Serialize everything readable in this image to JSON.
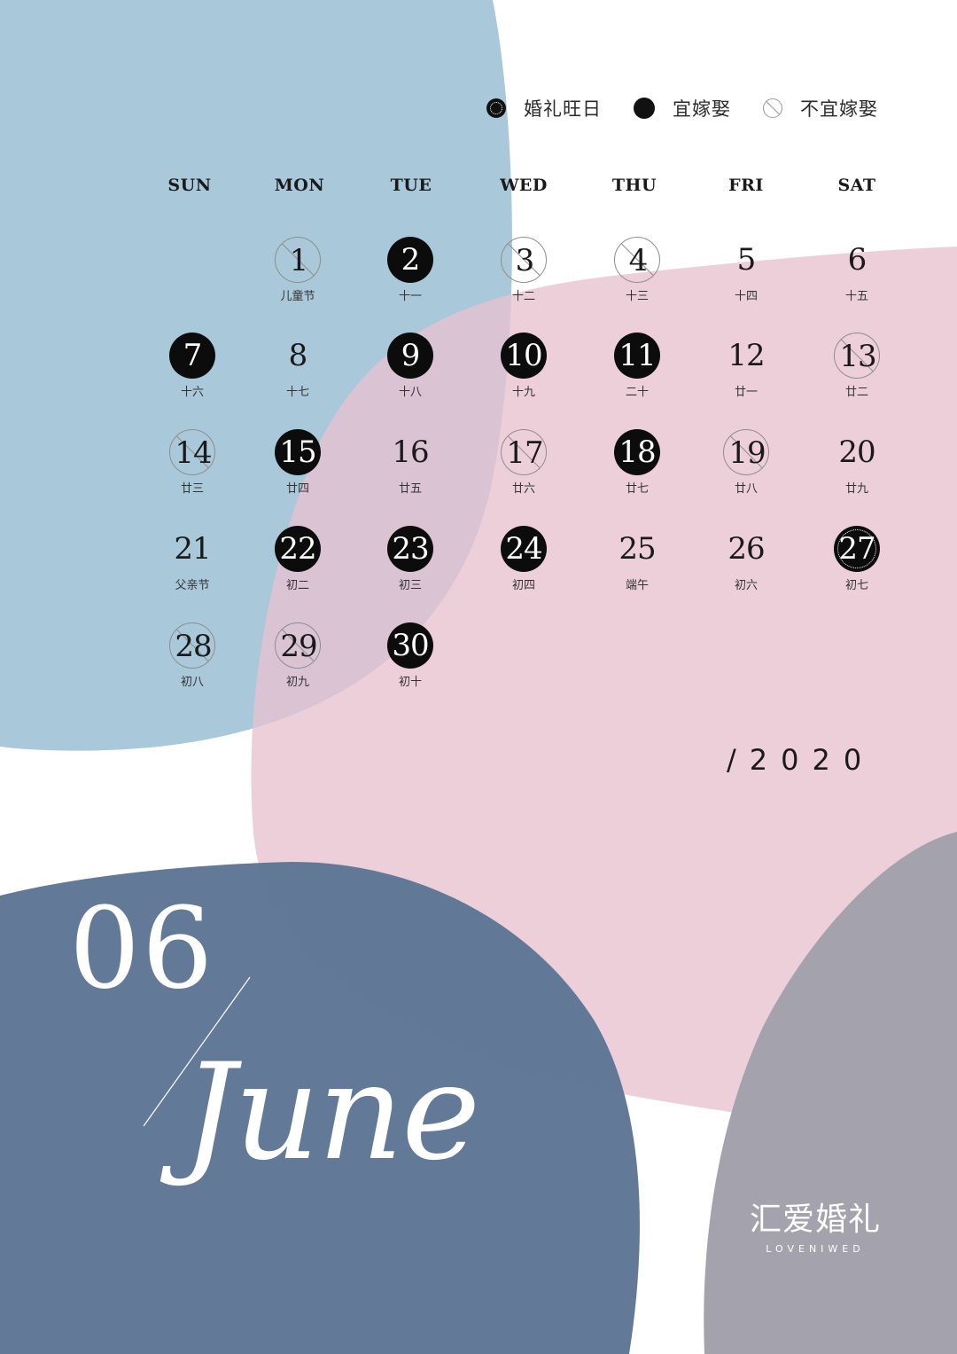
{
  "legend": [
    {
      "label": "婚礼旺日",
      "type": "wang"
    },
    {
      "label": "宜嫁娶",
      "type": "yi"
    },
    {
      "label": "不宜嫁娶",
      "type": "buyi"
    }
  ],
  "weekdays": [
    "SUN",
    "MON",
    "TUE",
    "WED",
    "THU",
    "FRI",
    "SAT"
  ],
  "days": [
    {
      "day": "1",
      "lunar": "儿童节",
      "mark": "buyi"
    },
    {
      "day": "2",
      "lunar": "十一",
      "mark": "yi"
    },
    {
      "day": "3",
      "lunar": "十二",
      "mark": "buyi"
    },
    {
      "day": "4",
      "lunar": "十三",
      "mark": "buyi"
    },
    {
      "day": "5",
      "lunar": "十四",
      "mark": "none"
    },
    {
      "day": "6",
      "lunar": "十五",
      "mark": "none"
    },
    {
      "day": "7",
      "lunar": "十六",
      "mark": "yi"
    },
    {
      "day": "8",
      "lunar": "十七",
      "mark": "none"
    },
    {
      "day": "9",
      "lunar": "十八",
      "mark": "yi"
    },
    {
      "day": "10",
      "lunar": "十九",
      "mark": "yi"
    },
    {
      "day": "11",
      "lunar": "二十",
      "mark": "yi"
    },
    {
      "day": "12",
      "lunar": "廿一",
      "mark": "none"
    },
    {
      "day": "13",
      "lunar": "廿二",
      "mark": "buyi"
    },
    {
      "day": "14",
      "lunar": "廿三",
      "mark": "buyi"
    },
    {
      "day": "15",
      "lunar": "廿四",
      "mark": "yi"
    },
    {
      "day": "16",
      "lunar": "廿五",
      "mark": "none"
    },
    {
      "day": "17",
      "lunar": "廿六",
      "mark": "buyi"
    },
    {
      "day": "18",
      "lunar": "廿七",
      "mark": "yi"
    },
    {
      "day": "19",
      "lunar": "廿八",
      "mark": "buyi"
    },
    {
      "day": "20",
      "lunar": "廿九",
      "mark": "none"
    },
    {
      "day": "21",
      "lunar": "父亲节",
      "mark": "none"
    },
    {
      "day": "22",
      "lunar": "初二",
      "mark": "yi"
    },
    {
      "day": "23",
      "lunar": "初三",
      "mark": "yi"
    },
    {
      "day": "24",
      "lunar": "初四",
      "mark": "yi"
    },
    {
      "day": "25",
      "lunar": "端午",
      "mark": "none"
    },
    {
      "day": "26",
      "lunar": "初六",
      "mark": "none"
    },
    {
      "day": "27",
      "lunar": "初七",
      "mark": "wang"
    },
    {
      "day": "28",
      "lunar": "初八",
      "mark": "buyi"
    },
    {
      "day": "29",
      "lunar": "初九",
      "mark": "buyi"
    },
    {
      "day": "30",
      "lunar": "初十",
      "mark": "yi"
    }
  ],
  "year": "/2020",
  "month_number": "06",
  "month_name": "June",
  "brand": {
    "cn": "汇爱婚礼",
    "en": "LOVENIWED"
  },
  "colors": {
    "blue_light": "#a9c8d9",
    "pink": "#edd0d9",
    "navy": "#5d7595",
    "gray": "#a4a2ad",
    "mark": "#0c0c0c"
  }
}
